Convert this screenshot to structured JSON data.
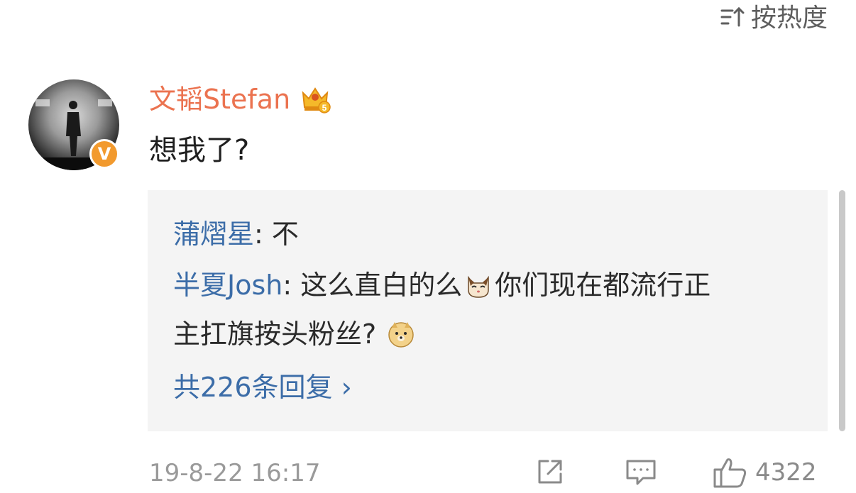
{
  "sort": {
    "label": "按热度",
    "icon": "sort-icon"
  },
  "comment": {
    "username": "文韬Stefan",
    "text": "想我了?",
    "timestamp": "19-8-22 16:17",
    "badges": {
      "avatar_badge": "V",
      "member_level": "5"
    }
  },
  "replies": [
    {
      "name": "蒲熠星",
      "text": ": 不"
    },
    {
      "name": "半夏Josh",
      "text": ": 这么直白的么",
      "text_after_emoji": "你们现在都流行正"
    },
    {
      "text": "主扛旗按头粉丝?"
    }
  ],
  "more_replies": "共226条回复 ›",
  "actions": {
    "share_icon": "share-icon",
    "reply_icon": "comment-icon",
    "like_icon": "thumbs-up-icon",
    "like_count": "4322"
  },
  "colors": {
    "username": "#eb7350",
    "reply_name": "#3c6da8",
    "reply_bg": "#f4f4f4",
    "muted": "#9a9a9a",
    "vbadge": "#f29a2e"
  }
}
